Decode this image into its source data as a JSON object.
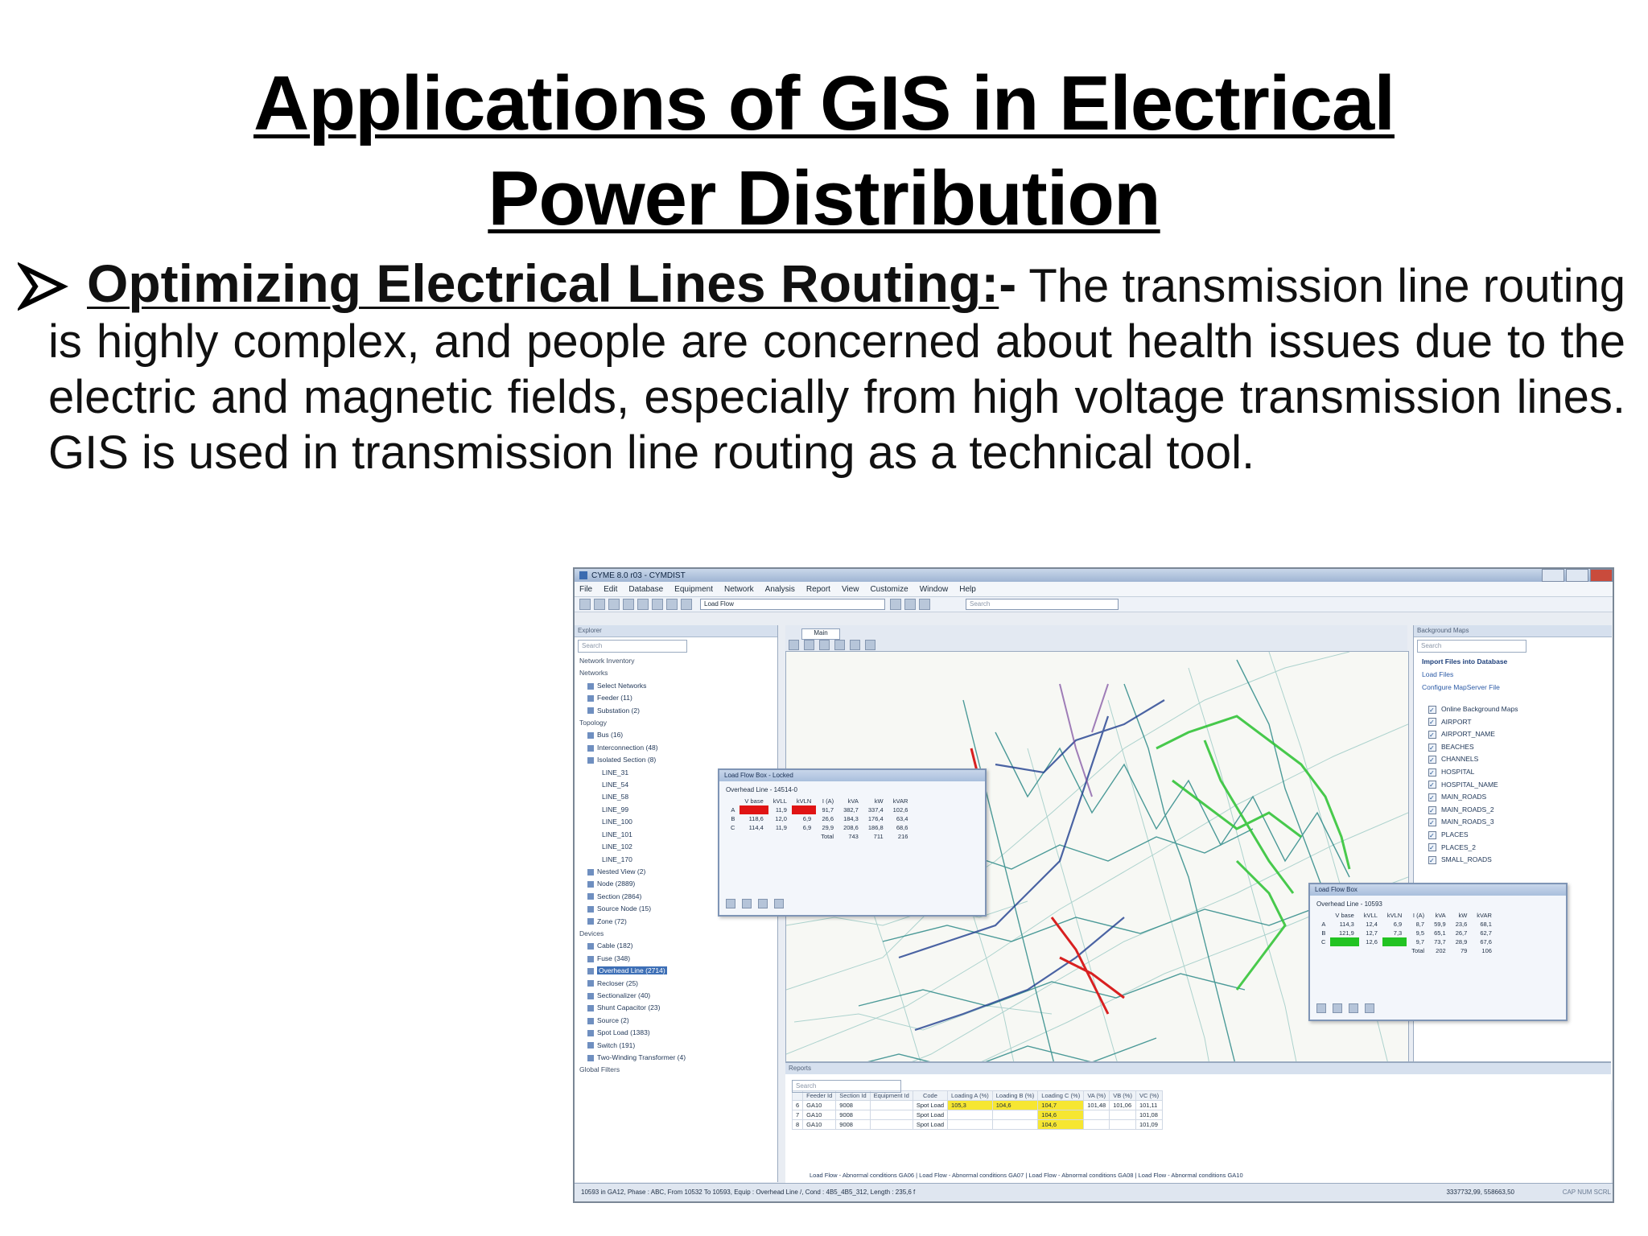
{
  "title": {
    "line1": "Applications of GIS in Electrical",
    "line2": "Power Distribution"
  },
  "bullet": {
    "icon": "arrow-bullet-icon",
    "heading": "Optimizing Electrical Lines Routing:",
    "separator": "-",
    "body": " The transmission line routing is highly complex, and people are concerned about health issues due to the electric and magnetic fields, especially from high voltage transmission lines. GIS is used in transmission line routing as a technical tool."
  },
  "screenshot": {
    "window_title": "CYME 8.0 r03 - CYMDIST",
    "menu": [
      "File",
      "Edit",
      "Database",
      "Equipment",
      "Network",
      "Analysis",
      "Report",
      "View",
      "Customize",
      "Window",
      "Help"
    ],
    "toolbar_select": "Load Flow",
    "toolbar_search": "Search",
    "left_pane": {
      "header": "Explorer",
      "search": "Search",
      "rows": [
        {
          "text": "Network Inventory",
          "type": "hdr"
        },
        {
          "text": "Networks",
          "type": "hdr"
        },
        {
          "text": "Select Networks",
          "type": "link"
        },
        {
          "text": "Feeder (11)",
          "type": "item"
        },
        {
          "text": "Substation (2)",
          "type": "item"
        },
        {
          "text": "Topology",
          "type": "hdr"
        },
        {
          "text": "Bus (16)",
          "type": "item"
        },
        {
          "text": "Interconnection (48)",
          "type": "item"
        },
        {
          "text": "Isolated Section (8)",
          "type": "item"
        },
        {
          "text": "LINE_31",
          "type": "sub"
        },
        {
          "text": "LINE_54",
          "type": "sub"
        },
        {
          "text": "LINE_58",
          "type": "sub"
        },
        {
          "text": "LINE_99",
          "type": "sub"
        },
        {
          "text": "LINE_100",
          "type": "sub"
        },
        {
          "text": "LINE_101",
          "type": "sub"
        },
        {
          "text": "LINE_102",
          "type": "sub"
        },
        {
          "text": "LINE_170",
          "type": "sub"
        },
        {
          "text": "Nested View (2)",
          "type": "item"
        },
        {
          "text": "Node (2889)",
          "type": "item"
        },
        {
          "text": "Section (2864)",
          "type": "item"
        },
        {
          "text": "Source Node (15)",
          "type": "item"
        },
        {
          "text": "Zone (72)",
          "type": "item"
        },
        {
          "text": "Devices",
          "type": "hdr"
        },
        {
          "text": "Cable (182)",
          "type": "item"
        },
        {
          "text": "Fuse (348)",
          "type": "item"
        },
        {
          "text": "Overhead Line (2714)",
          "type": "sel"
        },
        {
          "text": "Recloser (25)",
          "type": "item"
        },
        {
          "text": "Sectionalizer (40)",
          "type": "item"
        },
        {
          "text": "Shunt Capacitor (23)",
          "type": "item"
        },
        {
          "text": "Source (2)",
          "type": "item"
        },
        {
          "text": "Spot Load (1383)",
          "type": "item"
        },
        {
          "text": "Switch (191)",
          "type": "item"
        },
        {
          "text": "Two-Winding Transformer (4)",
          "type": "item"
        },
        {
          "text": "Global Filters",
          "type": "hdr"
        }
      ]
    },
    "map_tab": "Main",
    "right_pane": {
      "header": "Background Maps",
      "search": "Search",
      "import_link": "Import Files into Database",
      "load_files": "Load Files",
      "configure": "Configure MapServer File",
      "layers": [
        "Online Background Maps",
        "AIRPORT",
        "AIRPORT_NAME",
        "BEACHES",
        "CHANNELS",
        "HOSPITAL",
        "HOSPITAL_NAME",
        "MAIN_ROADS",
        "MAIN_ROADS_2",
        "MAIN_ROADS_3",
        "PLACES",
        "PLACES_2",
        "SMALL_ROADS"
      ]
    },
    "lf_box_1": {
      "title": "Load Flow Box - Locked",
      "subtitle": "Overhead Line - 14514-0",
      "headers": [
        "",
        "V base",
        "kVLL",
        "kVLN",
        "I (A)",
        "kVA",
        "kW",
        "kVAR"
      ],
      "rows": [
        [
          "A",
          "",
          "11,9",
          "",
          "91,7",
          "382,7",
          "337,4",
          "102,6"
        ],
        [
          "B",
          "118,6",
          "12,0",
          "6,9",
          "26,6",
          "184,3",
          "176,4",
          "63,4"
        ],
        [
          "C",
          "114,4",
          "11,9",
          "6,9",
          "29,9",
          "208,6",
          "186,8",
          "68,6"
        ],
        [
          "",
          "",
          "",
          "",
          "Total",
          "743",
          "711",
          "216"
        ]
      ]
    },
    "lf_box_2": {
      "title": "Load Flow Box",
      "subtitle": "Overhead Line - 10593",
      "headers": [
        "",
        "V base",
        "kVLL",
        "kVLN",
        "I (A)",
        "kVA",
        "kW",
        "kVAR"
      ],
      "rows": [
        [
          "A",
          "114,3",
          "12,4",
          "6,9",
          "8,7",
          "59,9",
          "23,6",
          "68,1"
        ],
        [
          "B",
          "121,9",
          "12,7",
          "7,3",
          "9,5",
          "65,1",
          "26,7",
          "62,7"
        ],
        [
          "C",
          "",
          "12,6",
          "",
          "9,7",
          "73,7",
          "28,9",
          "67,6"
        ],
        [
          "",
          "",
          "",
          "",
          "Total",
          "202",
          "79",
          "106"
        ]
      ]
    },
    "reports": {
      "header": "Reports",
      "search": "Search",
      "headers": [
        "",
        "Feeder Id",
        "Section Id",
        "Equipment Id",
        "Code",
        "Loading A (%)",
        "Loading B (%)",
        "Loading C (%)",
        "VA (%)",
        "VB (%)",
        "VC (%)"
      ],
      "rows": [
        [
          "6",
          "GA10",
          "9008",
          "",
          "Spot Load",
          "105,3",
          "104,6",
          "104,7",
          "101,48",
          "101,06",
          "101,11"
        ],
        [
          "7",
          "GA10",
          "9008",
          "",
          "Spot Load",
          "",
          "",
          "104,6",
          "",
          "",
          "101,08"
        ],
        [
          "8",
          "GA10",
          "9008",
          "",
          "Spot Load",
          "",
          "",
          "104,6",
          "",
          "",
          "101,09"
        ]
      ],
      "tabs": "Load Flow - Abnormal conditions GA06 | Load Flow - Abnormal conditions GA07 | Load Flow - Abnormal conditions GA08 | Load Flow - Abnormal conditions GA10"
    },
    "status": "10593 in GA12, Phase : ABC, From 10532 To 10593, Equip : Overhead Line /, Cond : 4B5_4B5_312, Length : 235,6 f",
    "coords": "3337732,99, 558663,50",
    "caps": "CAP NUM SCRL"
  }
}
